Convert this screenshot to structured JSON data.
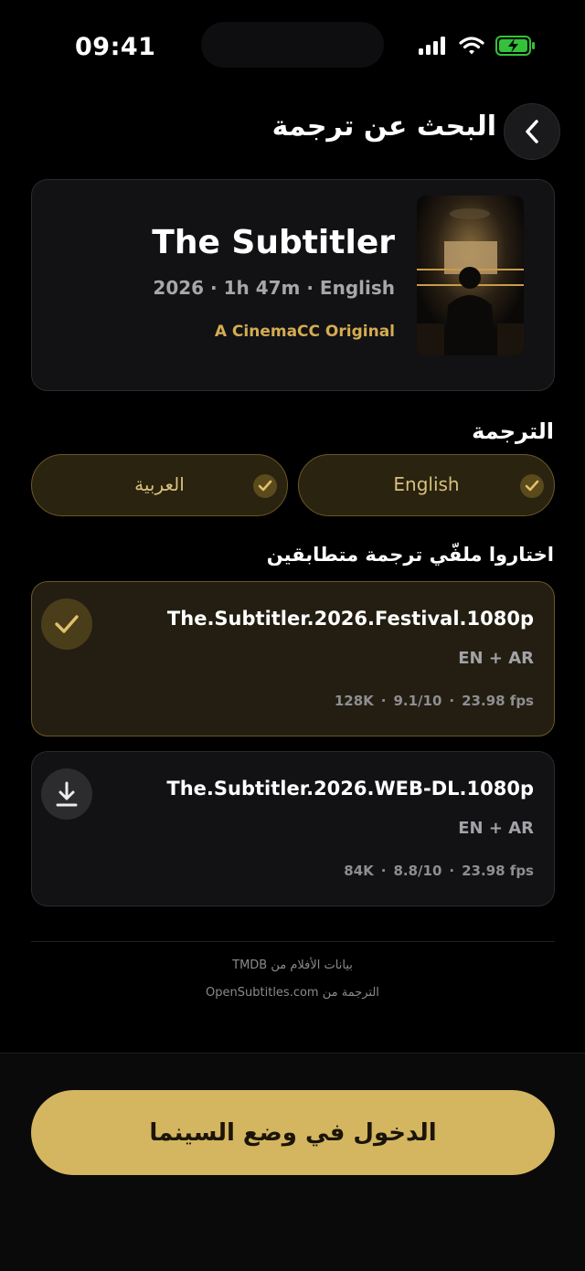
{
  "status_bar": {
    "time": "09:41"
  },
  "header": {
    "title": "البحث عن ترجمة"
  },
  "movie": {
    "title": "The Subtitler",
    "meta": "2026 · 1h 47m · English",
    "original": "A CinemaCC Original"
  },
  "subtitle_section": {
    "label": "الترجمة",
    "languages": [
      {
        "label": "English",
        "selected": true
      },
      {
        "label": "العربية",
        "selected": true
      }
    ]
  },
  "files_section": {
    "label": "اختاروا ملفّي ترجمة متطابقين",
    "files": [
      {
        "name": "The.Subtitler.2026.Festival.1080p",
        "langs": "EN + AR",
        "size": "128K",
        "rating": "9.1/10",
        "fps": "23.98 fps",
        "selected": true
      },
      {
        "name": "The.Subtitler.2026.WEB-DL.1080p",
        "langs": "EN + AR",
        "size": "84K",
        "rating": "8.8/10",
        "fps": "23.98 fps",
        "selected": false
      }
    ]
  },
  "credits": {
    "line1": "بيانات الأفلام من TMDB",
    "line2": "الترجمة من OpenSubtitles.com"
  },
  "cta": {
    "label": "الدخول في وضع السينما"
  },
  "colors": {
    "accent": "#d4b560",
    "accent_text": "#d4ac52",
    "background": "#000000"
  }
}
